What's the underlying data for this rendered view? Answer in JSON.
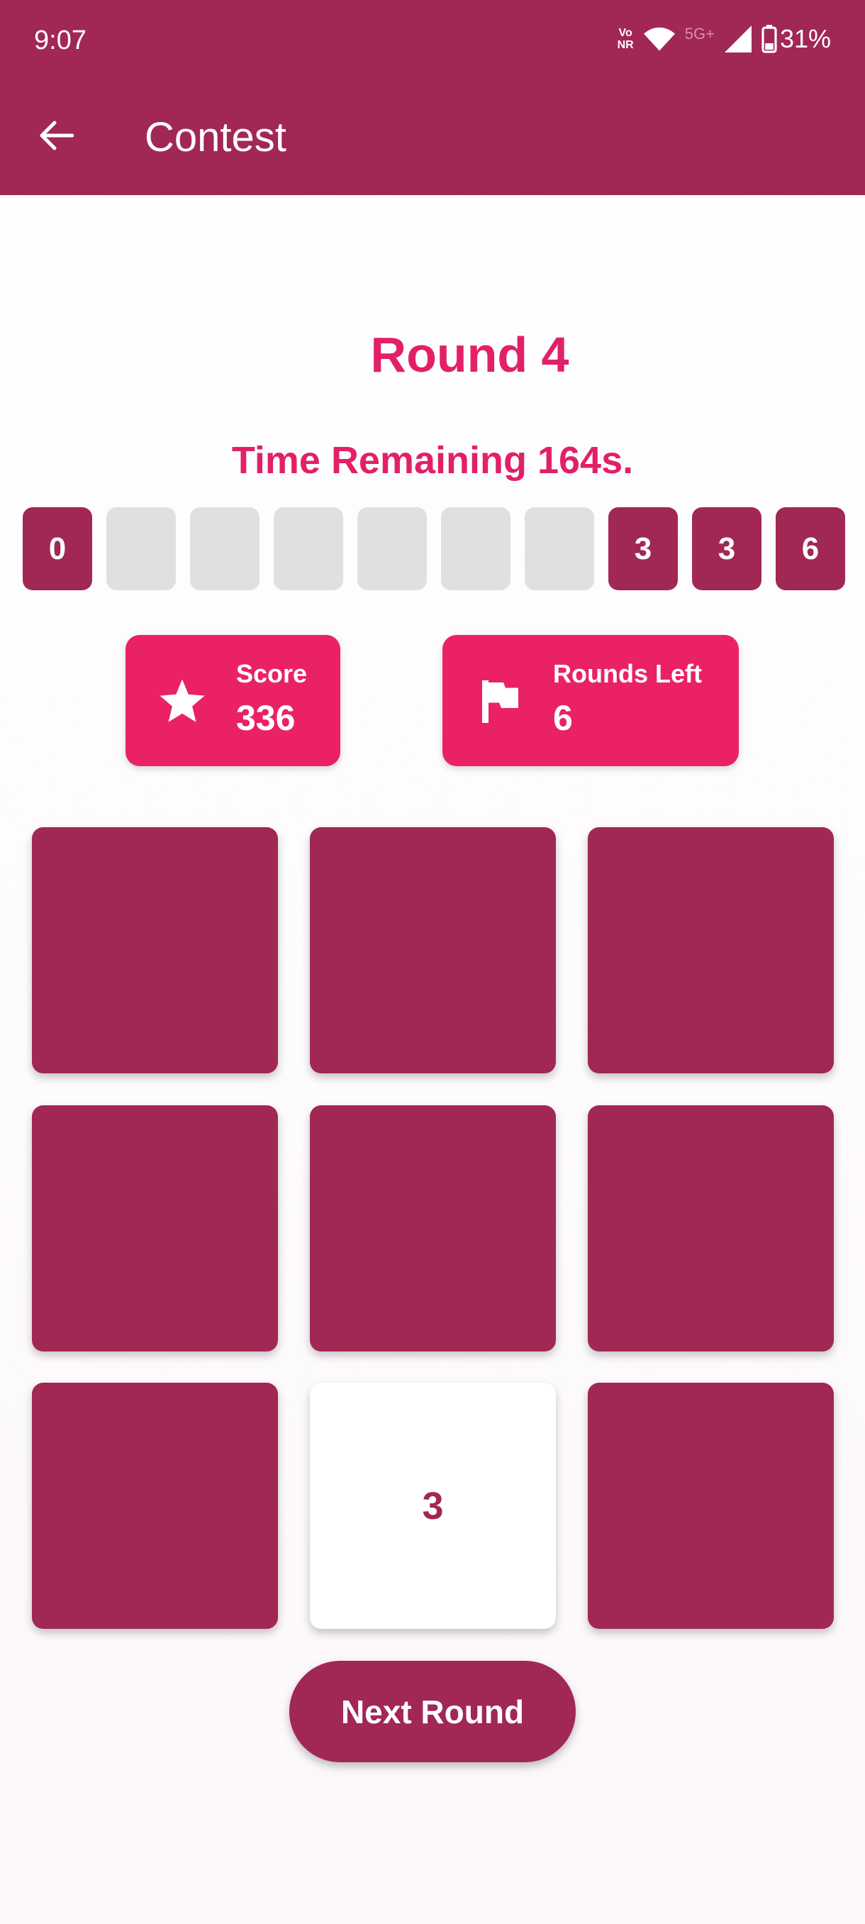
{
  "status_bar": {
    "time": "9:07",
    "network_badge": "Vo NR",
    "network_type": "5G+",
    "battery": "31%"
  },
  "app_bar": {
    "title": "Contest",
    "back_icon": "arrow-left-icon"
  },
  "game": {
    "round_label": "Round 4",
    "timer_label": "Time Remaining 164s.",
    "digits": [
      "0",
      "",
      "",
      "",
      "",
      "",
      "",
      "3",
      "3",
      "6"
    ],
    "score": {
      "label": "Score",
      "value": "336",
      "icon": "star-icon"
    },
    "rounds_left": {
      "label": "Rounds Left",
      "value": "6",
      "icon": "flag-icon"
    },
    "tiles": [
      "",
      "",
      "",
      "",
      "",
      "",
      "",
      "3",
      ""
    ],
    "revealed_tile_index": 7,
    "next_button": "Next Round"
  },
  "colors": {
    "primary": "#a12754",
    "accent": "#ea2265",
    "empty_slot": "#e0e0e0"
  }
}
